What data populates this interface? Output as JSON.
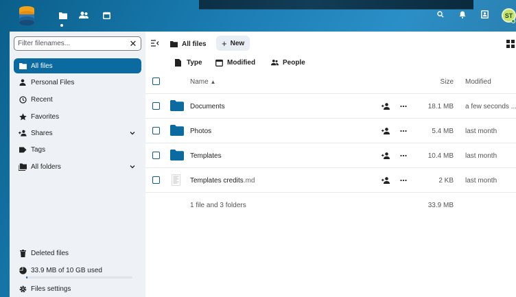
{
  "header": {
    "avatar_initials": "ST",
    "apps": [
      "files-icon",
      "contacts-icon",
      "calendar-icon"
    ],
    "right_icons": [
      "search-icon",
      "bell-icon",
      "contacts-menu-icon"
    ]
  },
  "sidebar": {
    "filter_placeholder": "Filter filenames...",
    "items": [
      {
        "label": "All files",
        "icon": "folder-icon",
        "active": true
      },
      {
        "label": "Personal Files",
        "icon": "user-icon"
      },
      {
        "label": "Recent",
        "icon": "history-icon"
      },
      {
        "label": "Favorites",
        "icon": "star-icon"
      },
      {
        "label": "Shares",
        "icon": "share-icon",
        "expandable": true
      },
      {
        "label": "Tags",
        "icon": "tag-icon"
      },
      {
        "label": "All folders",
        "icon": "folders-icon",
        "expandable": true
      }
    ],
    "bottom": {
      "deleted": "Deleted files",
      "quota": "33.9 MB of 10 GB used",
      "quota_fraction": 0.0034,
      "settings": "Files settings"
    }
  },
  "toolbar": {
    "breadcrumb": "All files",
    "new_label": "New"
  },
  "filters": {
    "type": "Type",
    "modified": "Modified",
    "people": "People"
  },
  "table": {
    "headers": {
      "name": "Name",
      "size": "Size",
      "modified": "Modified"
    },
    "rows": [
      {
        "name": "Documents",
        "ext": "",
        "kind": "folder",
        "size": "18.1 MB",
        "modified": "a few seconds ..."
      },
      {
        "name": "Photos",
        "ext": "",
        "kind": "folder",
        "size": "5.4 MB",
        "modified": "last month"
      },
      {
        "name": "Templates",
        "ext": "",
        "kind": "folder",
        "size": "10.4 MB",
        "modified": "last month"
      },
      {
        "name": "Templates credits",
        "ext": ".md",
        "kind": "file",
        "size": "2 KB",
        "modified": "last month"
      }
    ],
    "summary": {
      "text": "1 file and 3 folders",
      "size": "33.9 MB"
    }
  },
  "colors": {
    "primary": "#0b6aa0",
    "folder": "#0b6aa0",
    "sidebar_bg": "#eef2f6"
  }
}
